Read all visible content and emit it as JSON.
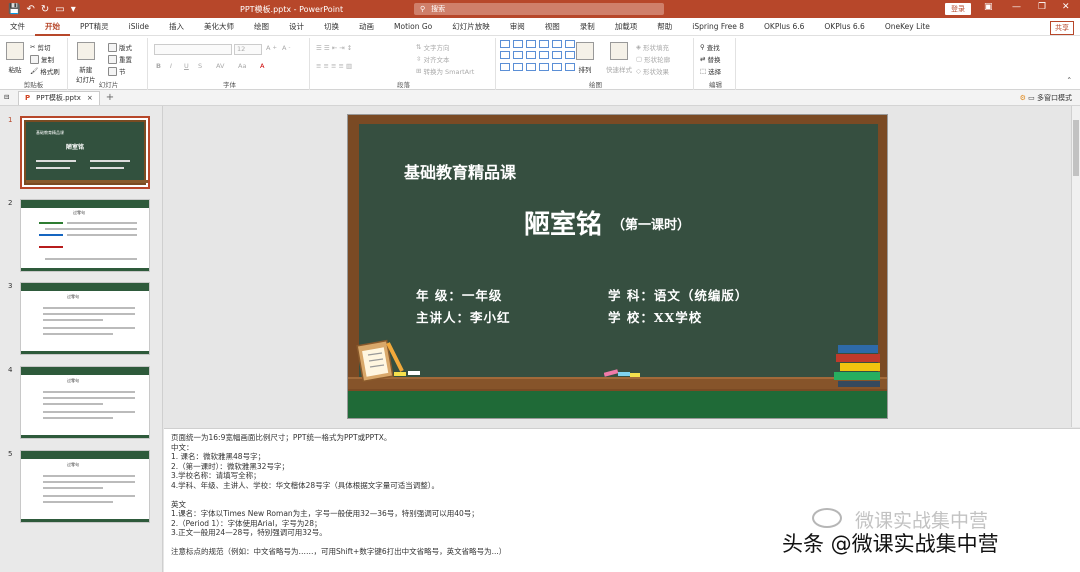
{
  "titlebar": {
    "doc_title": "PPT模板.pptx  -  PowerPoint",
    "search_placeholder": "搜索",
    "login": "登录",
    "minimize": "—",
    "restore": "❐",
    "close": "✕"
  },
  "tabs": [
    "文件",
    "开始",
    "PPT精灵",
    "iSlide",
    "插入",
    "美化大师",
    "绘图",
    "设计",
    "切换",
    "动画",
    "Motion Go",
    "幻灯片放映",
    "审阅",
    "视图",
    "录制",
    "加载项",
    "帮助",
    "iSpring Free 8",
    "OKPlus 6.6",
    "OKPlus 6.6",
    "OneKey Lite"
  ],
  "share": "共享",
  "ribbon": {
    "clipboard": {
      "paste": "粘贴",
      "cut": "剪切",
      "copy": "复制",
      "format_painter": "格式刷",
      "label": "剪贴板"
    },
    "slides": {
      "new_slide": "新建\n幻灯片",
      "layout": "版式",
      "reset": "重置",
      "section": "节",
      "label": "幻灯片"
    },
    "font": {
      "size": "12",
      "bold": "B",
      "italic": "I",
      "underline": "U",
      "strike": "S",
      "label": "字体"
    },
    "paragraph": {
      "text_direction": "文字方向",
      "align_text": "对齐文本",
      "smartart": "转换为 SmartArt",
      "label": "段落"
    },
    "drawing": {
      "arrange": "排列",
      "quick_styles": "快速样式",
      "shape_fill": "形状填充",
      "shape_outline": "形状轮廓",
      "shape_effects": "形状效果",
      "label": "绘图"
    },
    "editing": {
      "find": "查找",
      "replace": "替换",
      "select": "选择",
      "label": "编辑"
    }
  },
  "doctab": {
    "name": "PPT模板.pptx",
    "close": "×",
    "add": "+"
  },
  "multi_window": "多窗口模式",
  "thumbnails": [
    {
      "num": "1",
      "title": "陋室铭",
      "subtitle": "基础教育精品课"
    },
    {
      "num": "2",
      "title": "过零句"
    },
    {
      "num": "3",
      "title": "过零句"
    },
    {
      "num": "4",
      "title": "过零句"
    },
    {
      "num": "5",
      "title": "过零句"
    }
  ],
  "slide": {
    "course": "基础教育精品课",
    "title": "陋室铭",
    "title_sub": "（第一课时）",
    "grade": "年   级：一年级",
    "subject": "学   科：语文（统编版）",
    "teacher": "主讲人：李小红",
    "school": "学   校：XX学校"
  },
  "notes": {
    "lines_cn": [
      "页面统一为16:9宽幅画面比例尺寸；PPT统一格式为PPT或PPTX。",
      "中文：",
      "1. 课名：微软雅黑48号字；",
      "2.（第一课时）：微软雅黑32号字；",
      "3.学校名称：请填写全称；",
      "4.学科、年级、主讲人、学校：华文楷体28号字（具体根据文字量可适当调整）。"
    ],
    "lines_en": [
      "英文",
      "1.课名：字体以Times New Roman为主，字号一般使用32—36号，特别强调可以用40号；",
      "2.（Period 1）：字体使用Arial，字号为28；",
      "3.正文一般用24—28号，特别强调可用32号。"
    ],
    "footer": "注意标点的规范（例如：中文省略号为……，可用Shift+数字键6打出中文省略号，英文省略号为...）"
  },
  "watermark": {
    "wechat": "微课实战集中营",
    "toutiao": "头条 @微课实战集中营"
  }
}
